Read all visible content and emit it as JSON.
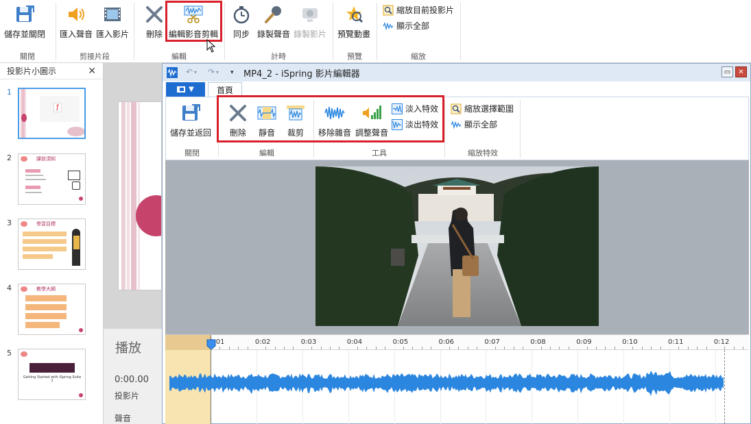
{
  "main_ribbon": {
    "close_group": {
      "save_close": "儲存並關閉",
      "label": "關閉"
    },
    "clip_group": {
      "import_audio": "匯入聲音",
      "import_video": "匯入影片",
      "label": "剪接片段"
    },
    "edit_group": {
      "delete": "刪除",
      "edit_clip": "編輯影音剪輯",
      "label": "編輯"
    },
    "timing_group": {
      "sync": "同步",
      "record_audio": "錄製聲音",
      "record_video": "錄製影片",
      "label": "計時"
    },
    "preview_group": {
      "preview_anim": "預覽動畫",
      "label": "預覽"
    },
    "zoom_group": {
      "zoom_current": "縮放目前投影片",
      "show_all": "顯示全部",
      "label": "縮放"
    }
  },
  "slide_panel": {
    "title": "投影片小圖示",
    "slides": [
      {
        "number": "1"
      },
      {
        "number": "2",
        "heading": "課前須知"
      },
      {
        "number": "3",
        "heading": "學習目標"
      },
      {
        "number": "4",
        "heading": "教學大綱"
      },
      {
        "number": "5",
        "caption": "Getting Started with iSpring Suite 7"
      }
    ]
  },
  "timeline_labels": {
    "play": "播放",
    "time": "0:00.00",
    "slides": "投影片",
    "audio": "聲音"
  },
  "editor_window": {
    "title": "MP4_2 - iSpring 影片編輯器",
    "home_tab": "首頁",
    "close_group": {
      "save_return": "儲存並返回",
      "label": "關閉"
    },
    "edit_group": {
      "delete": "刪除",
      "mute": "靜音",
      "trim": "裁剪",
      "label": "編輯"
    },
    "tools_group": {
      "remove_noise": "移除雜音",
      "adjust_volume": "調整聲音",
      "fade_in": "淡入特效",
      "fade_out": "淡出特效",
      "label": "工具"
    },
    "zoom_group": {
      "zoom_selection": "縮放選擇範圍",
      "show_all": "顯示全部",
      "label": "縮放特效"
    },
    "ruler_ticks": [
      "0:01",
      "0:02",
      "0:03",
      "0:04",
      "0:05",
      "0:06",
      "0:07",
      "0:08",
      "0:09",
      "0:10",
      "0:11",
      "0:12"
    ]
  },
  "colors": {
    "highlight": "#d81f2a",
    "accent": "#1d6dd1",
    "waveform": "#2b86e0",
    "selection": "#f7e4b0"
  }
}
